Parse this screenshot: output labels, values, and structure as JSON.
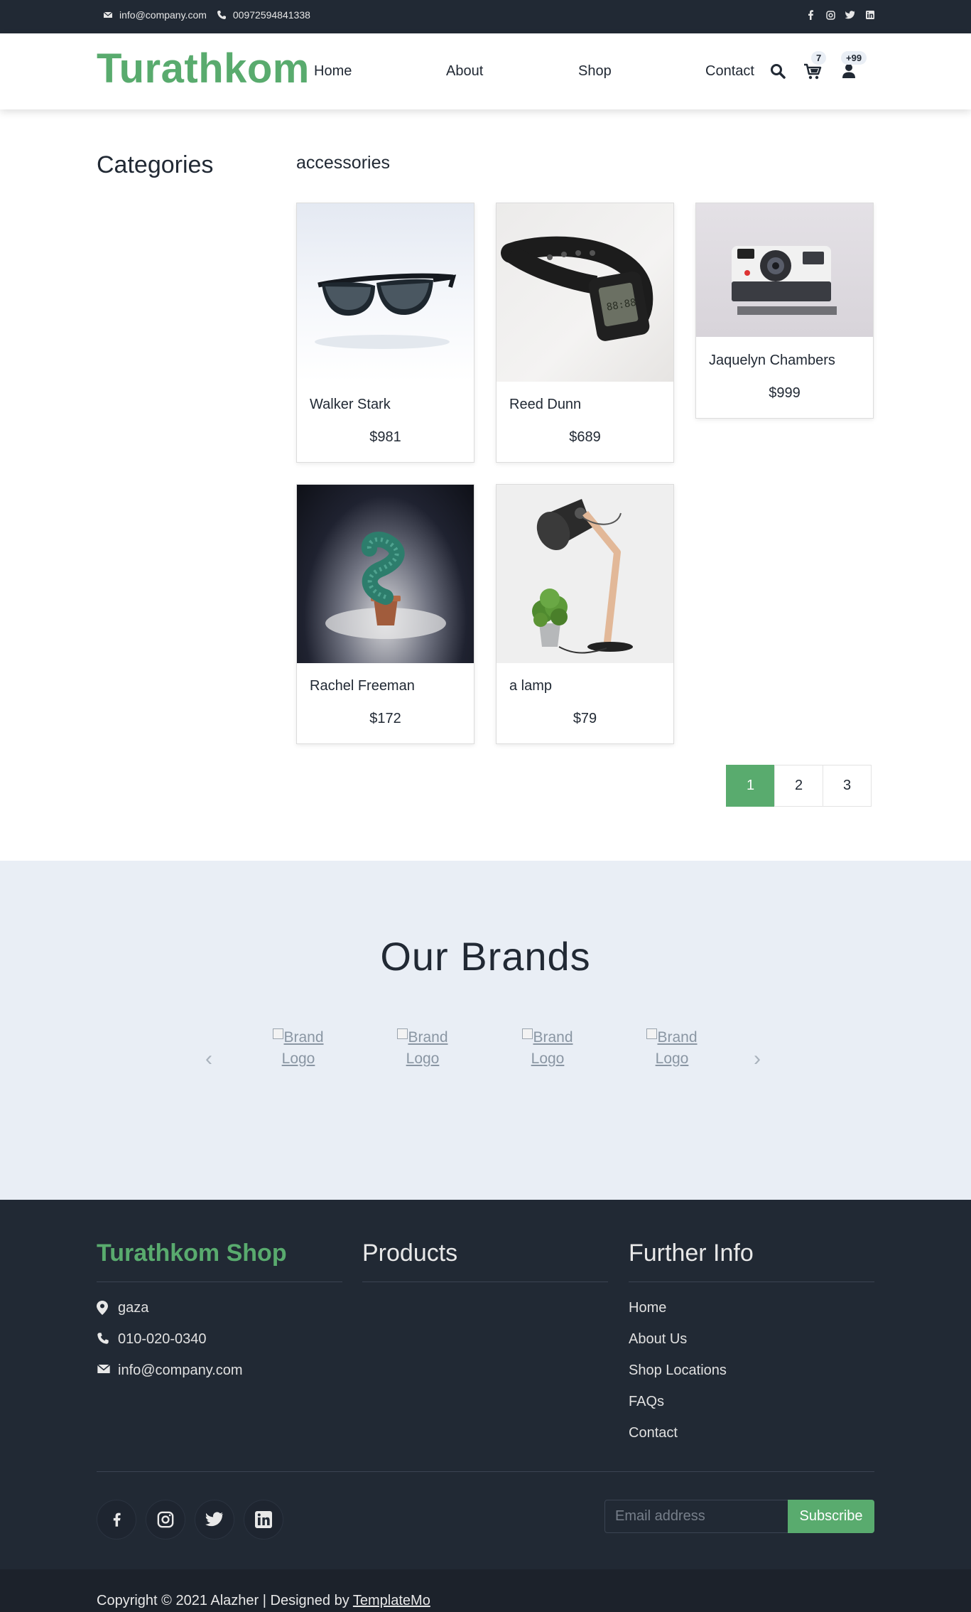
{
  "topbar": {
    "email": "info@company.com",
    "phone": "00972594841338",
    "socials": [
      "facebook-icon",
      "instagram-icon",
      "twitter-icon",
      "linkedin-icon"
    ]
  },
  "header": {
    "logo": "Turathkom",
    "nav": [
      "Home",
      "About",
      "Shop",
      "Contact"
    ],
    "cart_count": "7",
    "user_count": "+99"
  },
  "sidebar": {
    "title": "Categories"
  },
  "main": {
    "category": "accessories",
    "products": [
      {
        "name": "Walker Stark",
        "price": "$981",
        "image": "sunglasses"
      },
      {
        "name": "Reed Dunn",
        "price": "$689",
        "image": "watch"
      },
      {
        "name": "Jaquelyn Chambers",
        "price": "$999",
        "image": "camera"
      },
      {
        "name": "Rachel Freeman",
        "price": "$172",
        "image": "cactus"
      },
      {
        "name": "a lamp",
        "price": "$79",
        "image": "lamp"
      }
    ],
    "pagination": [
      "1",
      "2",
      "3"
    ],
    "active_page": "1"
  },
  "brands": {
    "title": "Our Brands",
    "items": [
      "Brand Logo",
      "Brand Logo",
      "Brand Logo",
      "Brand Logo"
    ],
    "prev": "‹",
    "next": "›"
  },
  "footer": {
    "shop_title": "Turathkom Shop",
    "address": "gaza",
    "phone": "010-020-0340",
    "email": "info@company.com",
    "products_title": "Products",
    "info_title": "Further Info",
    "info_links": [
      "Home",
      "About Us",
      "Shop Locations",
      "FAQs",
      "Contact"
    ],
    "email_placeholder": "Email address",
    "subscribe": "Subscribe",
    "copyright_prefix": "Copyright © 2021 Alazher | Designed by ",
    "copyright_link": "TemplateMo"
  },
  "colors": {
    "accent": "#59ab6e",
    "dark": "#212934",
    "light_bg": "#e9eef5"
  }
}
